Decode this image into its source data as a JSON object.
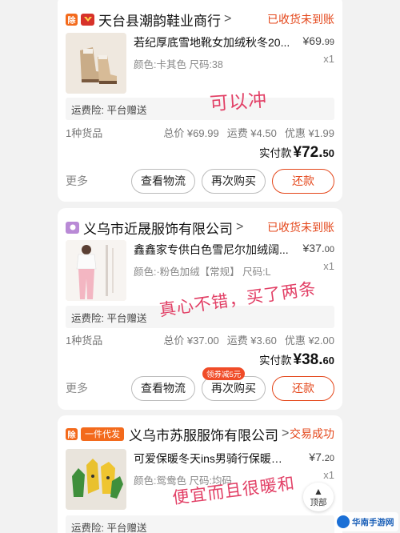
{
  "orders": [
    {
      "shop": "天台县潮韵鞋业商行",
      "status": "已收货未到账",
      "product_title": "若纪厚底雪地靴女加绒秋冬20...",
      "product_spec": "颜色:卡其色  尺码:38",
      "price_int": "¥69.",
      "price_dec": "99",
      "qty": "x1",
      "insurance": "运费险:  平台赠送",
      "count": "1种货品",
      "total": "总价 ¥69.99",
      "freight": "运费 ¥4.50",
      "discount": "优惠 ¥1.99",
      "paid_label": "实付款",
      "paid_int": "¥72.",
      "paid_dec": "50",
      "more": "更多",
      "btn_logistics": "查看物流",
      "btn_rebuy": "再次购买",
      "btn_pay": "还款"
    },
    {
      "shop": "义乌市近晟服饰有限公司",
      "status": "已收货未到账",
      "product_title": "鑫鑫家专供白色雪尼尔加绒阔...",
      "product_spec": "颜色:·粉色加绒【常规】 尺码:L",
      "price_int": "¥37.",
      "price_dec": "00",
      "qty": "x1",
      "insurance": "运费险:  平台赠送",
      "count": "1种货品",
      "total": "总价 ¥37.00",
      "freight": "运费 ¥3.60",
      "discount": "优惠 ¥2.00",
      "paid_label": "实付款",
      "paid_int": "¥38.",
      "paid_dec": "60",
      "more": "更多",
      "btn_logistics": "查看物流",
      "btn_rebuy": "再次购买",
      "coupon": "领券减5元",
      "btn_pay": "还款"
    },
    {
      "tag": "一件代发",
      "shop": "义乌市苏服服饰有限公司",
      "status": "交易成功",
      "product_title": "可爱保暖冬天ins男骑行保暖防寒...",
      "product_spec": "颜色:鸳鸯色  尺码:均码",
      "price_int": "¥7.",
      "price_dec": "20",
      "qty": "x1",
      "insurance": "运费险:  平台赠送"
    }
  ],
  "pay_badge": "除",
  "annotations": [
    "可以冲",
    "真心不错，买了两条",
    "便宜而且很暖和"
  ],
  "back_to_top": "顶部",
  "watermark": "华南手游网",
  "colors": {
    "accent": "#e4471b",
    "handwriting": "#e24066"
  }
}
